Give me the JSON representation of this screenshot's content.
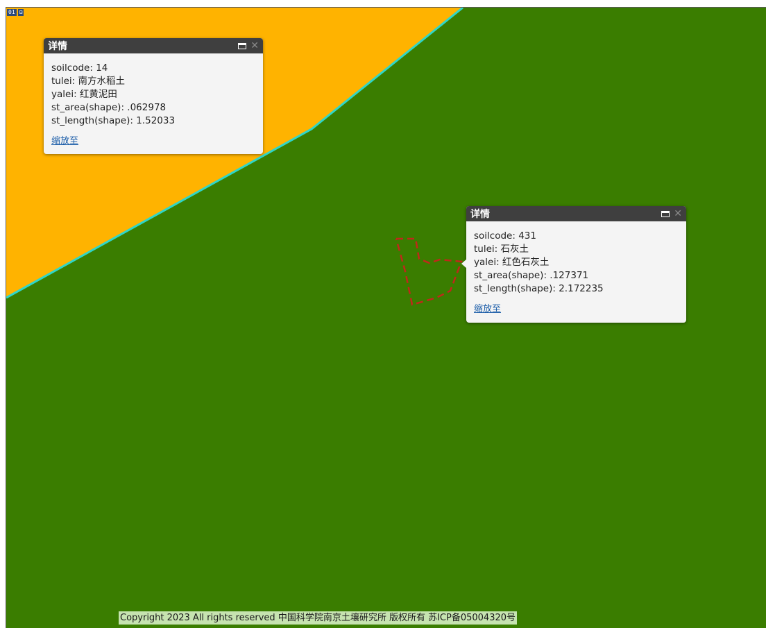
{
  "map": {
    "background_color": "#3a7d00",
    "polygon_fill_color": "#ffb300",
    "polygon_outline_color": "#2fd6c8",
    "selection_outline_color": "#c0281a",
    "corner_badge": [
      "01",
      "⊡"
    ]
  },
  "popups": [
    {
      "title": "详情",
      "rows": [
        "soilcode: 14",
        "tulei: 南方水稻土",
        "yalei: 红黄泥田",
        "st_area(shape): .062978",
        "st_length(shape): 1.52033"
      ],
      "zoom_label": "缩放至"
    },
    {
      "title": "详情",
      "rows": [
        "soilcode: 431",
        "tulei: 石灰土",
        "yalei: 红色石灰土",
        "st_area(shape): .127371",
        "st_length(shape): 2.172235"
      ],
      "zoom_label": "缩放至"
    }
  ],
  "footer": {
    "copyright": "Copyright 2023 All rights reserved 中国科学院南京土壤研究所 版权所有 苏ICP备05004320号"
  }
}
